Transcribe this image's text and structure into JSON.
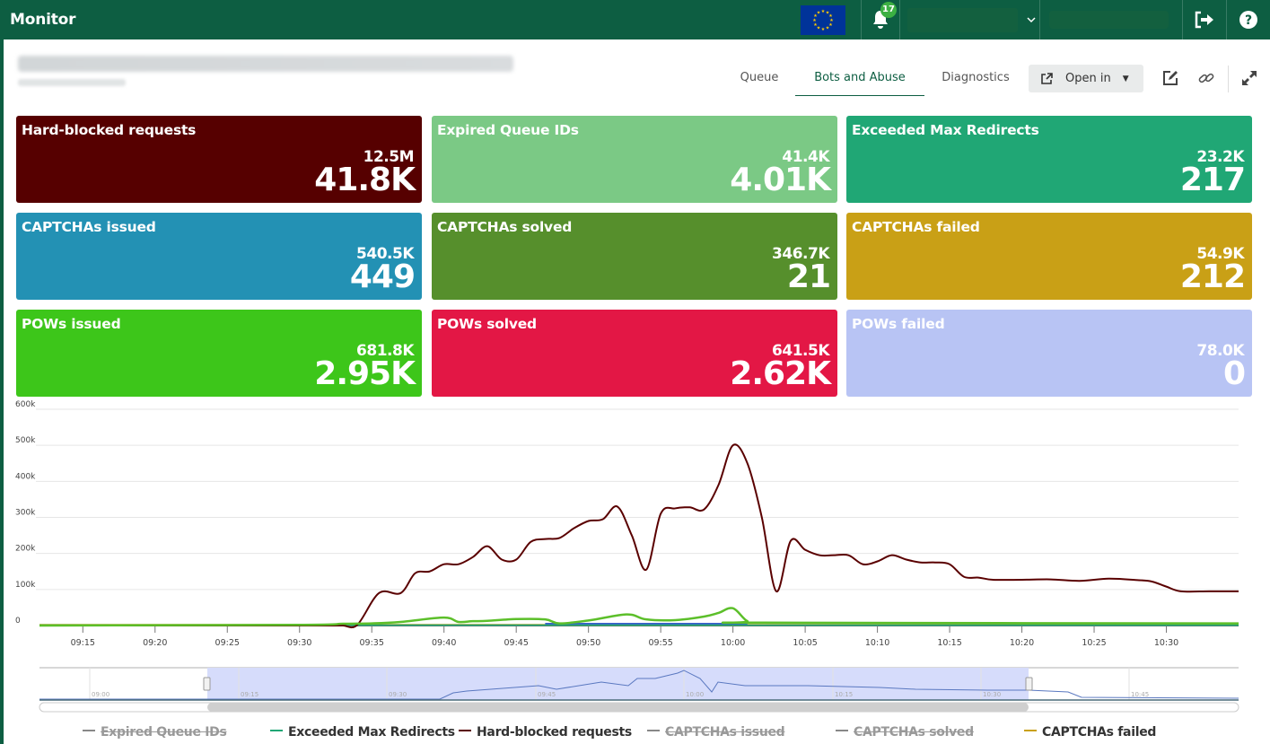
{
  "header": {
    "app_title": "Monitor",
    "notification_count": "17",
    "icons": [
      "eu-flag-icon",
      "bell-icon",
      "chevron-down-icon",
      "logout-icon",
      "help-icon"
    ]
  },
  "page": {
    "title": "(blurred)",
    "subtitle": "(blurred)"
  },
  "tabs": [
    {
      "label": "Queue",
      "active": false
    },
    {
      "label": "Bots and Abuse",
      "active": true
    },
    {
      "label": "Diagnostics",
      "active": false
    }
  ],
  "toolbar": {
    "open_in_label": "Open in",
    "icons": [
      "external-link-icon",
      "caret-down-icon",
      "edit-icon",
      "link-icon",
      "expand-icon"
    ]
  },
  "tiles": [
    {
      "name": "Hard-blocked requests",
      "sub": "12.5M",
      "value": "41.8K",
      "color": "#560000"
    },
    {
      "name": "Expired Queue IDs",
      "sub": "41.4K",
      "value": "4.01K",
      "color": "#7bc985"
    },
    {
      "name": "Exceeded Max Redirects",
      "sub": "23.2K",
      "value": "217",
      "color": "#20a775"
    },
    {
      "name": "CAPTCHAs issued",
      "sub": "540.5K",
      "value": "449",
      "color": "#2391b4"
    },
    {
      "name": "CAPTCHAs solved",
      "sub": "346.7K",
      "value": "21",
      "color": "#568f2c"
    },
    {
      "name": "CAPTCHAs failed",
      "sub": "54.9K",
      "value": "212",
      "color": "#c9a016"
    },
    {
      "name": "POWs issued",
      "sub": "681.8K",
      "value": "2.95K",
      "color": "#3dc61a"
    },
    {
      "name": "POWs solved",
      "sub": "641.5K",
      "value": "2.62K",
      "color": "#e31745"
    },
    {
      "name": "POWs failed",
      "sub": "78.0K",
      "value": "0",
      "color": "#b8c4f4"
    }
  ],
  "chart_data": {
    "type": "line",
    "title": "",
    "xlabel": "",
    "ylabel": "",
    "x_range": [
      "09:12",
      "10:35"
    ],
    "ylim": [
      0,
      600000
    ],
    "y_ticks": [
      "0",
      "100k",
      "200k",
      "300k",
      "400k",
      "500k",
      "600k"
    ],
    "x_ticks": [
      "09:15",
      "09:20",
      "09:25",
      "09:30",
      "09:35",
      "09:40",
      "09:45",
      "09:50",
      "09:55",
      "10:00",
      "10:05",
      "10:10",
      "10:15",
      "10:20",
      "10:25",
      "10:30"
    ],
    "grid": true,
    "series": [
      {
        "name": "Hard-blocked requests",
        "color": "#5a0000",
        "x_minutes_from_0912": [
          0,
          10,
          20,
          21,
          22,
          23.5,
          25,
          26,
          27,
          28,
          29,
          30,
          31,
          32,
          33,
          34,
          35,
          36,
          37,
          38,
          39,
          40,
          41,
          42,
          43,
          44,
          45,
          46,
          47,
          48,
          49,
          50,
          51,
          52,
          53,
          54,
          55,
          56,
          57,
          58,
          59,
          60,
          61,
          62,
          63,
          64,
          65,
          66,
          68,
          70,
          72,
          74,
          76,
          77,
          78,
          79,
          81,
          83
        ],
        "values_k": [
          0,
          0,
          0,
          0,
          2,
          90,
          90,
          145,
          150,
          170,
          170,
          190,
          220,
          183,
          183,
          232,
          240,
          243,
          270,
          290,
          295,
          330,
          250,
          155,
          310,
          325,
          328,
          322,
          390,
          500,
          450,
          300,
          95,
          235,
          210,
          195,
          195,
          195,
          170,
          178,
          195,
          183,
          175,
          175,
          170,
          135,
          133,
          127,
          127,
          128,
          124,
          130,
          126,
          122,
          108,
          95,
          95,
          95
        ]
      },
      {
        "name": "POWs issued (green, unlabeled in legend row)",
        "color": "#5cbf2a",
        "x_minutes_from_0912": [
          0,
          18,
          21,
          23,
          25,
          28,
          29,
          30,
          31,
          33,
          35,
          36,
          38,
          40,
          41,
          42,
          44,
          46,
          47,
          48,
          49,
          50,
          83
        ],
        "values_k": [
          0,
          2,
          5,
          6,
          10,
          22,
          10,
          12,
          13,
          18,
          17,
          6,
          14,
          28,
          30,
          17,
          15,
          25,
          35,
          48,
          12,
          8,
          6
        ]
      },
      {
        "name": "Expired Queue IDs",
        "color": "#888888",
        "hidden": true,
        "values_k": []
      },
      {
        "name": "Exceeded Max Redirects",
        "color": "#20a775",
        "values_k": [
          0
        ]
      },
      {
        "name": "CAPTCHAs issued",
        "color": "#888888",
        "hidden": true,
        "values_k": []
      },
      {
        "name": "CAPTCHAs solved",
        "color": "#888888",
        "hidden": true,
        "values_k": []
      },
      {
        "name": "CAPTCHAs failed",
        "color": "#c9a016",
        "values_k": [
          0
        ]
      }
    ],
    "navigator": {
      "x_ticks": [
        "09:00",
        "09:15",
        "09:30",
        "09:45",
        "10:00",
        "10:15",
        "10:30",
        "10:45"
      ],
      "selected_range": [
        "09:12",
        "10:35"
      ]
    },
    "legend": [
      {
        "label": "Expired Queue IDs",
        "color": "#888888",
        "hidden": true
      },
      {
        "label": "Exceeded Max Redirects",
        "color": "#20a775",
        "hidden": false
      },
      {
        "label": "Hard-blocked requests",
        "color": "#5a0000",
        "hidden": false
      },
      {
        "label": "CAPTCHAs issued",
        "color": "#888888",
        "hidden": true
      },
      {
        "label": "CAPTCHAs solved",
        "color": "#888888",
        "hidden": true
      },
      {
        "label": "CAPTCHAs failed",
        "color": "#c9a016",
        "hidden": false
      }
    ],
    "legend_position": "bottom"
  }
}
